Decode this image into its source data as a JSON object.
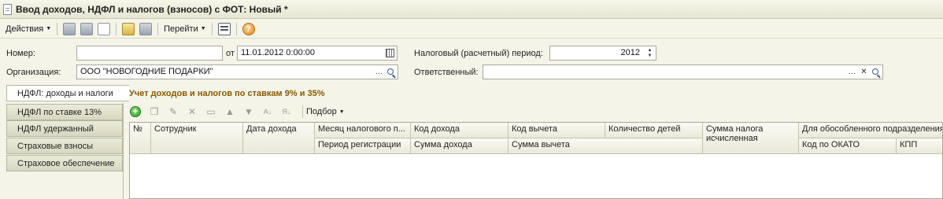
{
  "window": {
    "title": "Ввод доходов, НДФЛ и налогов (взносов) с ФОТ: Новый *"
  },
  "toolbar": {
    "actions_label": "Действия",
    "goto_label": "Перейти"
  },
  "form": {
    "number_label": "Номер:",
    "number_value": "",
    "date_label": "от",
    "date_value": "11.01.2012  0:00:00",
    "tax_period_label": "Налоговый (расчетный) период:",
    "tax_period_value": "2012",
    "organization_label": "Организация:",
    "organization_value": "ООО \"НОВОГОДНИЕ ПОДАРКИ\"",
    "responsible_label": "Ответственный:",
    "responsible_value": ""
  },
  "tabs": [
    {
      "label": "НДФЛ: доходы и налоги",
      "active": true
    },
    {
      "label": "НДФЛ по ставке 13%"
    },
    {
      "label": "НДФЛ удержанный"
    },
    {
      "label": "Страховые взносы"
    },
    {
      "label": "Страховое обеспечение"
    }
  ],
  "section": {
    "title": "Учет доходов и налогов по ставкам 9% и 35%",
    "selection_label": "Подбор"
  },
  "table": {
    "columns": {
      "num": "№",
      "employee": "Сотрудник",
      "income_date": "Дата дохода",
      "tax_month": "Месяц налогового п...",
      "registration_period": "Период регистрации",
      "income_code": "Код дохода",
      "income_amount": "Сумма дохода",
      "deduction_code": "Код вычета",
      "deduction_amount": "Сумма вычета",
      "children_count": "Количество детей",
      "tax_amount": "Сумма налога исчисленная",
      "separate_unit": "Для обособленного подразделения",
      "okato_code": "Код по ОКАТО",
      "kpp": "КПП"
    },
    "rows": []
  }
}
